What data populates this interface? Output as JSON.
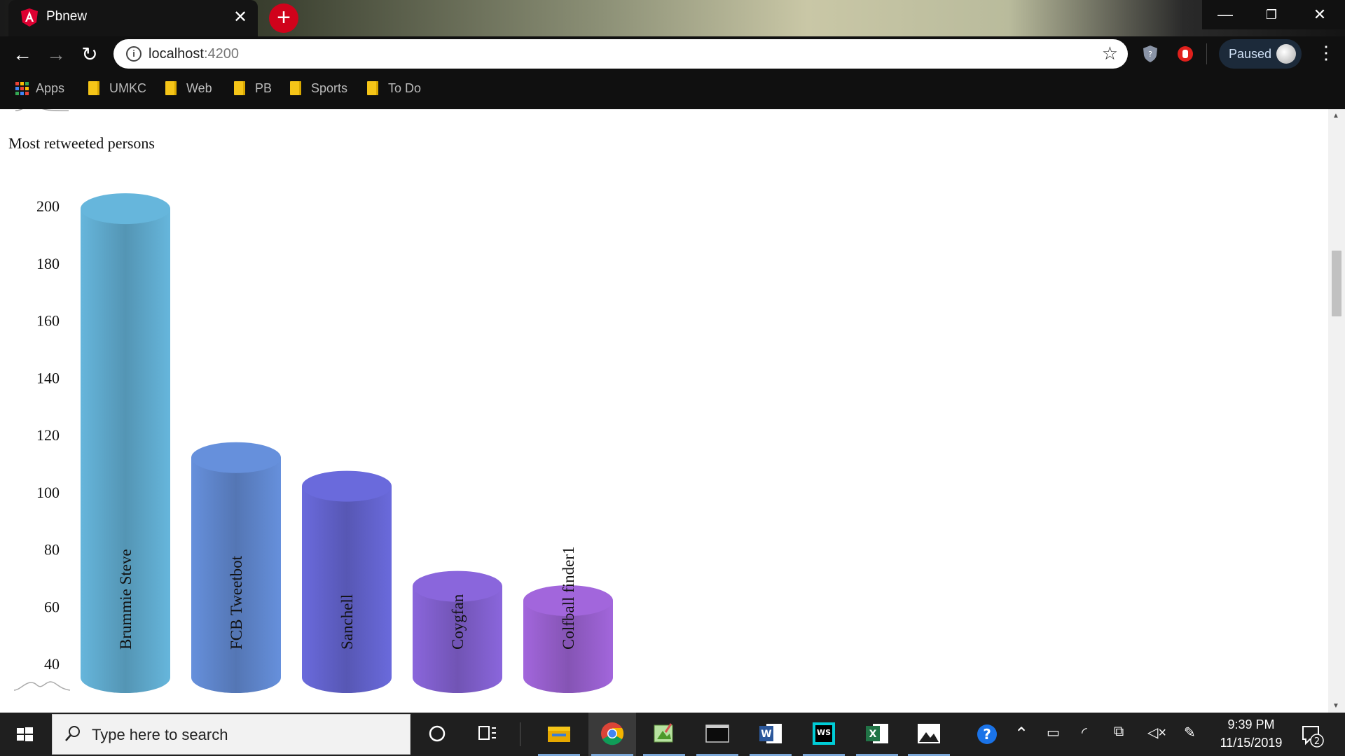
{
  "browser": {
    "tab_title": "Pbnew",
    "tab_close": "✕",
    "new_tab": "+",
    "url_host": "localhost",
    "url_port": ":4200",
    "profile_status": "Paused",
    "bookmarks": [
      "Apps",
      "UMKC",
      "Web",
      "PB",
      "Sports",
      "To Do"
    ]
  },
  "page": {
    "chart_title": "Most retweeted persons"
  },
  "chart_data": {
    "type": "bar",
    "bar_style": "cylinder",
    "categories": [
      "Brummie Steve",
      "FCB Tweetbot",
      "Sanchell",
      "Coygfan",
      "Colfball finder1"
    ],
    "values": [
      199,
      112,
      102,
      67,
      62
    ],
    "ylim": [
      40,
      200
    ],
    "yticks": [
      40,
      60,
      80,
      100,
      120,
      140,
      160,
      180,
      200
    ],
    "colors": [
      "#66b6dc",
      "#6690dc",
      "#6a6adc",
      "#8a66dc",
      "#a266dc"
    ]
  },
  "taskbar": {
    "search_placeholder": "Type here to search",
    "time": "9:39 PM",
    "date": "11/15/2019",
    "notifications": "2"
  }
}
